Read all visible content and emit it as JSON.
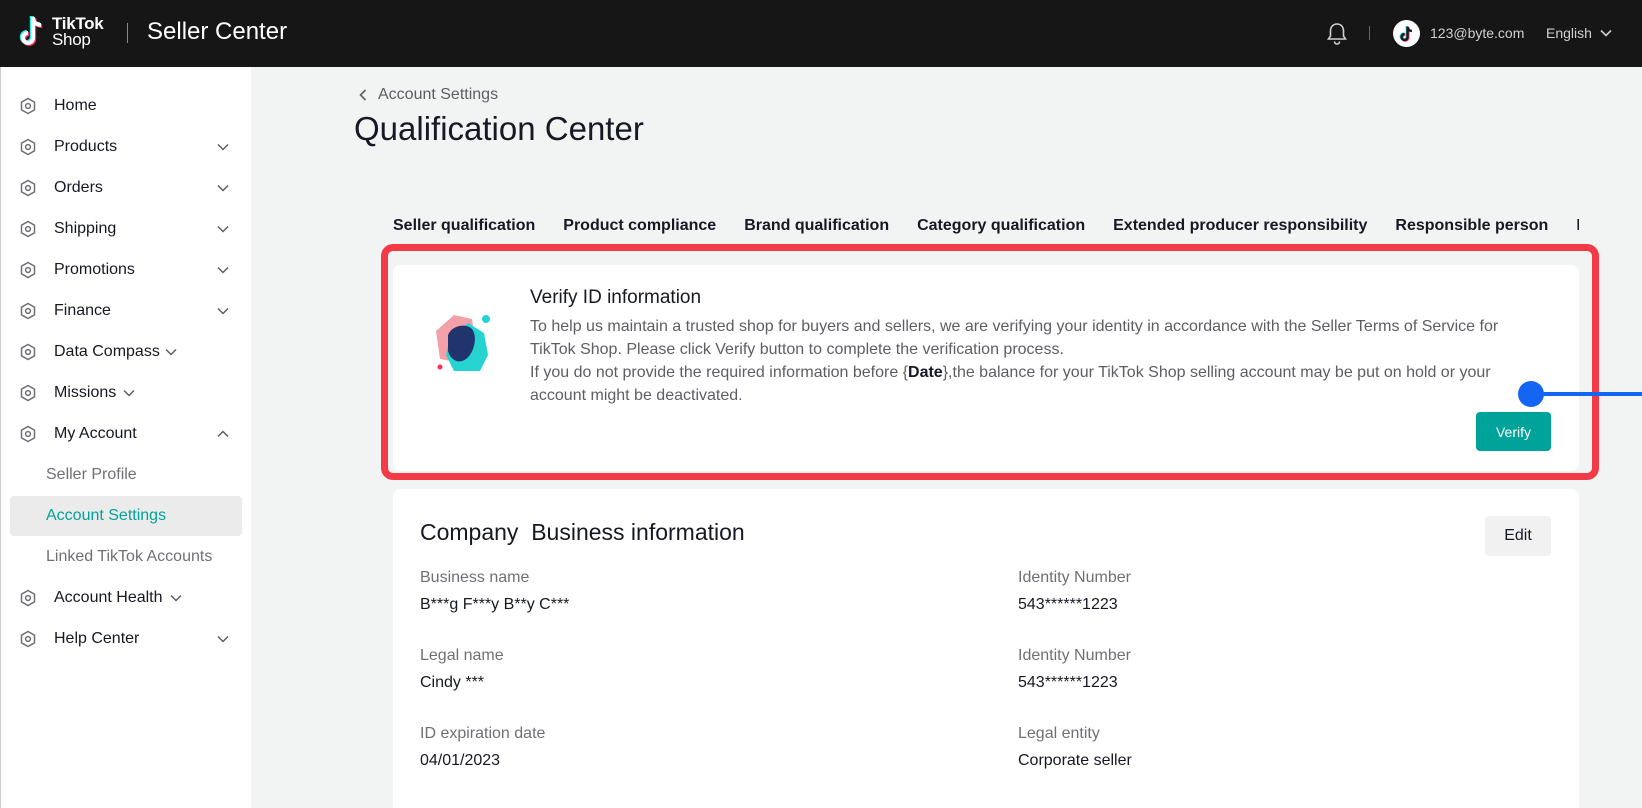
{
  "header": {
    "logo_line1": "TikTok",
    "logo_line2": "Shop",
    "app_title": "Seller Center",
    "user_email": "123@byte.com",
    "language": "English"
  },
  "sidebar": {
    "items": [
      {
        "label": "Home"
      },
      {
        "label": "Products"
      },
      {
        "label": "Orders"
      },
      {
        "label": "Shipping"
      },
      {
        "label": "Promotions"
      },
      {
        "label": "Finance"
      },
      {
        "label": "Data Compass"
      },
      {
        "label": "Missions"
      },
      {
        "label": "My Account"
      },
      {
        "label": "Seller Profile"
      },
      {
        "label": "Account Settings"
      },
      {
        "label": "Linked TikTok Accounts"
      },
      {
        "label": "Account Health"
      },
      {
        "label": "Help Center"
      }
    ]
  },
  "page": {
    "breadcrumb": "Account Settings",
    "title": "Qualification Center"
  },
  "tabs": [
    "Seller qualification",
    "Product compliance",
    "Brand qualification",
    "Category qualification",
    "Extended producer responsibility",
    "Responsible person",
    "Ma"
  ],
  "verify": {
    "title": "Verify ID information",
    "desc_line1": "To help us maintain a trusted shop for buyers and sellers, we are verifying your identity in accordance with the Seller Terms of Service for TikTok Shop. Please click Verify button to complete the verification process.",
    "desc_line2_pre": "If you do not provide the required information before {",
    "desc_line2_bold": "Date",
    "desc_line2_post": "},the balance for your TikTok Shop selling account may be put on hold or your account might be deactivated.",
    "button": "Verify"
  },
  "company": {
    "title": "Company  Business information",
    "edit_button": "Edit",
    "fields": [
      {
        "label": "Business name",
        "value": "B***g F***y B**y C***"
      },
      {
        "label": "Identity Number",
        "value": "543******1223"
      },
      {
        "label": "Legal name",
        "value": "Cindy ***"
      },
      {
        "label": "Identity Number",
        "value": "543******1223"
      },
      {
        "label": "ID expiration date",
        "value": "04/01/2023"
      },
      {
        "label": "Legal entity",
        "value": "Corporate seller"
      }
    ]
  },
  "colors": {
    "accent": "#00a39a",
    "highlight": "#f33b48",
    "connector": "#1565f5"
  }
}
